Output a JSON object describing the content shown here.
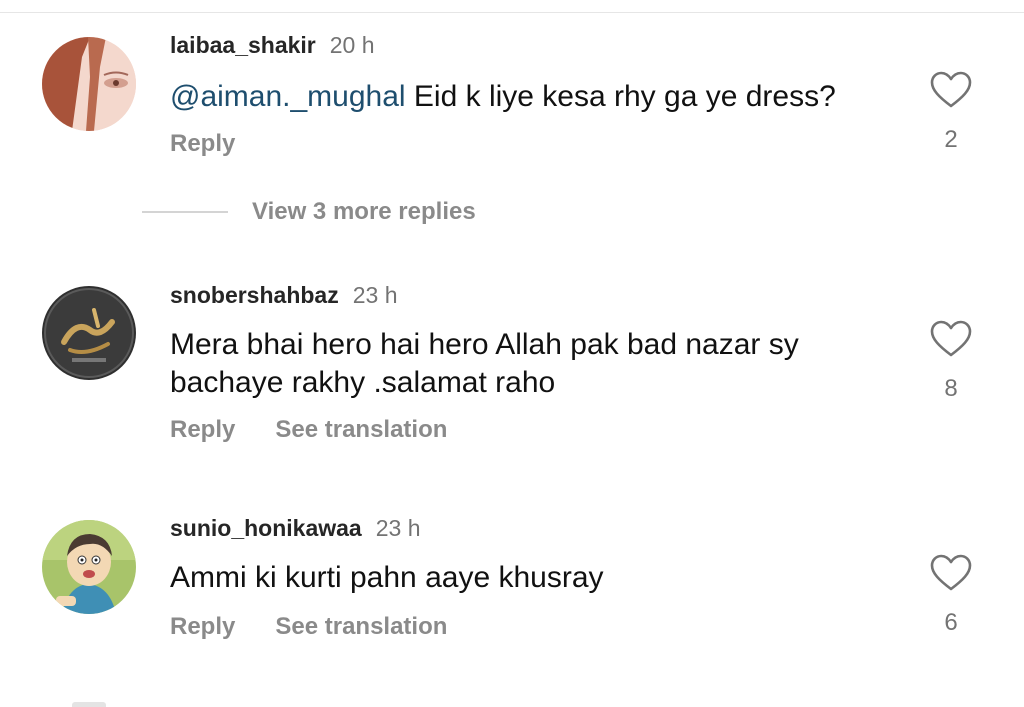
{
  "colors": {
    "username": "#262626",
    "secondary_text": "#737373",
    "action_text": "#8a8a8a",
    "mention": "#1e4e6e",
    "heart_outline": "#737373"
  },
  "comments": [
    {
      "username": "laibaa_shakir",
      "time": "20 h",
      "mention": "@aiman._mughal",
      "text": "Eid k liye kesa rhy ga ye dress?",
      "reply_label": "Reply",
      "like_count": "2",
      "like_icon": "heart-outline-icon",
      "view_replies_label": "View 3 more replies"
    },
    {
      "username": "snobershahbaz",
      "time": "23 h",
      "text": "Mera bhai hero hai hero Allah pak bad nazar sy bachaye rakhy .salamat raho",
      "reply_label": "Reply",
      "translation_label": "See translation",
      "like_count": "8",
      "like_icon": "heart-outline-icon"
    },
    {
      "username": "sunio_honikawaa",
      "time": "23 h",
      "text": "Ammi ki kurti pahn aaye khusray",
      "reply_label": "Reply",
      "translation_label": "See translation",
      "like_count": "6",
      "like_icon": "heart-outline-icon"
    }
  ]
}
